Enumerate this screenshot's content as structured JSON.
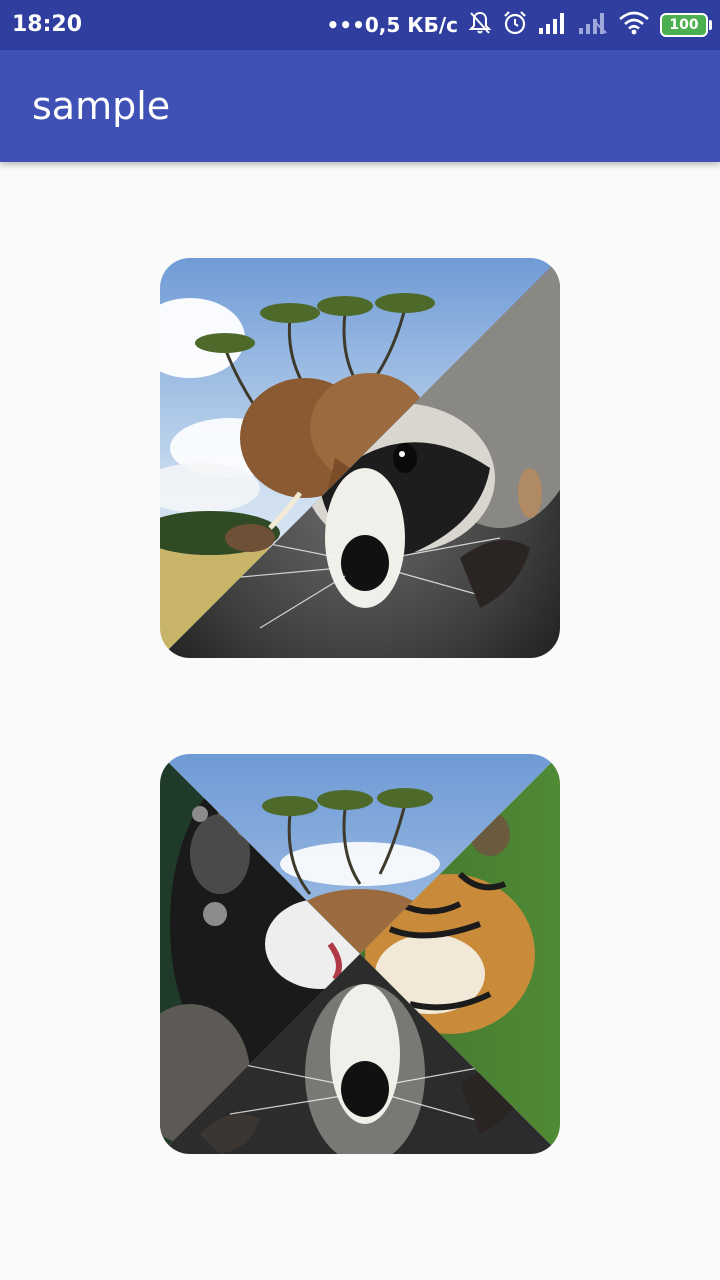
{
  "status_bar": {
    "time": "18:20",
    "network_speed": "•••0,5 КБ/с",
    "battery_level": "100",
    "icons": [
      "notifications-off-icon",
      "alarm-icon",
      "signal-icon",
      "signal-weak-icon",
      "wifi-icon",
      "battery-icon"
    ]
  },
  "app_bar": {
    "title": "sample"
  },
  "images": [
    {
      "name": "diagonal-split-image",
      "photos": [
        "elephant",
        "raccoon"
      ]
    },
    {
      "name": "four-way-split-image",
      "photos": [
        "elephant",
        "badger",
        "tiger",
        "raccoon"
      ]
    }
  ],
  "colors": {
    "status_bar": "#303f9f",
    "app_bar": "#3f51b5",
    "background": "#fafafa",
    "battery": "#4caf50"
  }
}
